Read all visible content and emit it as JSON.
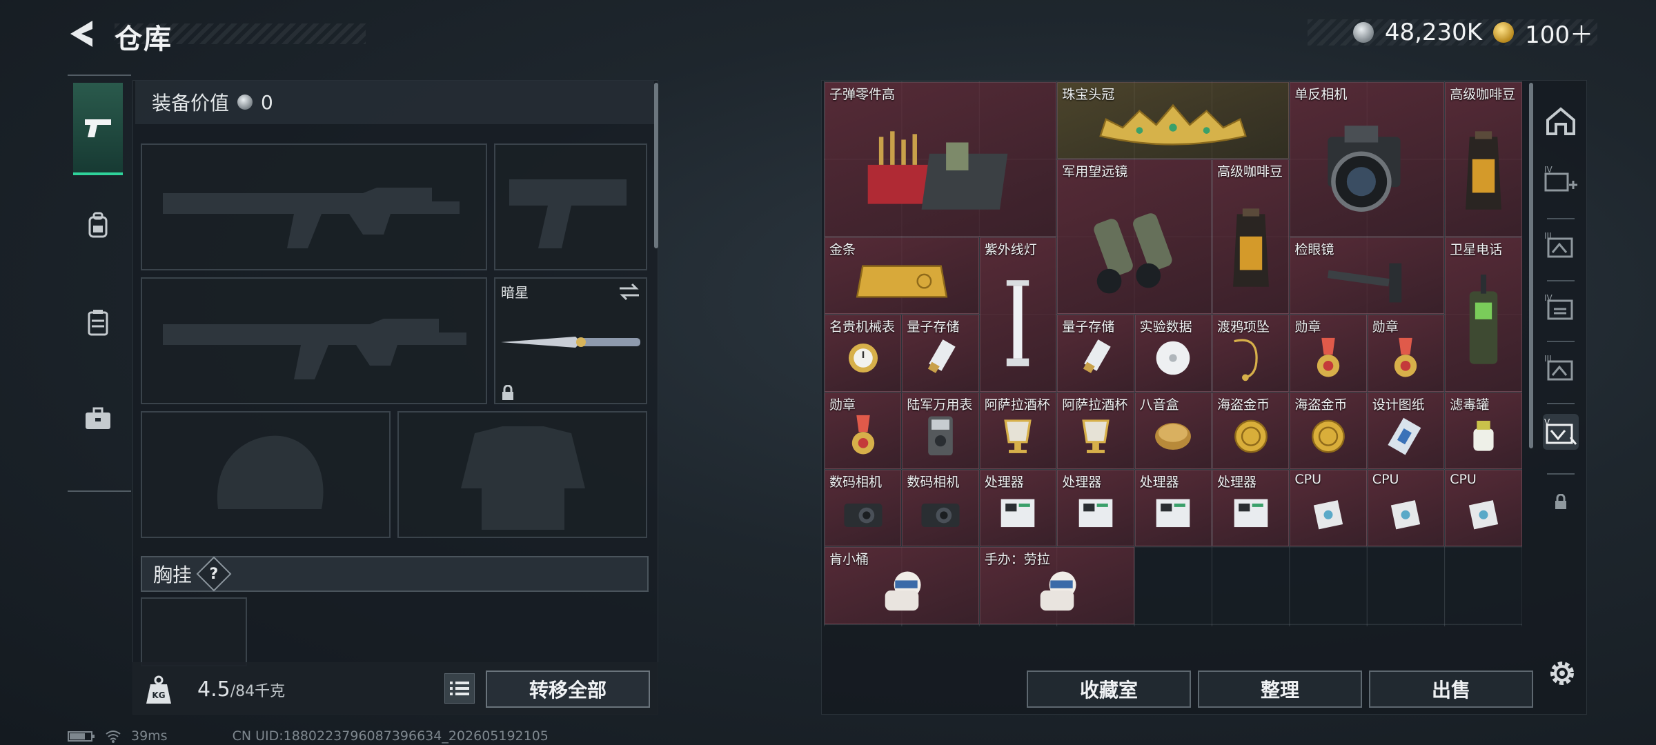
{
  "header": {
    "title": "仓库"
  },
  "currency": {
    "silver": "48,230K",
    "gold": "100＋"
  },
  "left": {
    "equip_label": "装备价值",
    "equip_value": "0",
    "slot_melee_label": "暗星",
    "chest_label": "胸挂",
    "chest_hint": "?",
    "weight_current": "4.5",
    "weight_max": "/84千克",
    "weight_badge": "KG",
    "transfer_label": "转移全部"
  },
  "items": [
    {
      "label": "子弹零件高",
      "rarity": "red"
    },
    {
      "label": "珠宝头冠",
      "rarity": "gold"
    },
    {
      "label": "单反相机",
      "rarity": "red"
    },
    {
      "label": "高级咖啡豆",
      "rarity": "red"
    },
    {
      "label": "军用望远镜",
      "rarity": "red"
    },
    {
      "label": "高级咖啡豆",
      "rarity": "red"
    },
    {
      "label": "金条",
      "rarity": "red"
    },
    {
      "label": "紫外线灯",
      "rarity": "red"
    },
    {
      "label": "检眼镜",
      "rarity": "red"
    },
    {
      "label": "卫星电话",
      "rarity": "red"
    },
    {
      "label": "名贵机械表",
      "rarity": "red"
    },
    {
      "label": "量子存储",
      "rarity": "red"
    },
    {
      "label": "量子存储",
      "rarity": "red"
    },
    {
      "label": "实验数据",
      "rarity": "red"
    },
    {
      "label": "渡鸦项坠",
      "rarity": "red"
    },
    {
      "label": "勋章",
      "rarity": "red"
    },
    {
      "label": "勋章",
      "rarity": "red"
    },
    {
      "label": "勋章",
      "rarity": "red"
    },
    {
      "label": "陆军万用表",
      "rarity": "red"
    },
    {
      "label": "阿萨拉酒杯",
      "rarity": "red"
    },
    {
      "label": "阿萨拉酒杯",
      "rarity": "red"
    },
    {
      "label": "八音盒",
      "rarity": "red"
    },
    {
      "label": "海盗金币",
      "rarity": "red"
    },
    {
      "label": "海盗金币",
      "rarity": "red"
    },
    {
      "label": "设计图纸",
      "rarity": "red"
    },
    {
      "label": "滤毒罐",
      "rarity": "red"
    },
    {
      "label": "数码相机",
      "rarity": "red"
    },
    {
      "label": "数码相机",
      "rarity": "red"
    },
    {
      "label": "处理器",
      "rarity": "red"
    },
    {
      "label": "处理器",
      "rarity": "red"
    },
    {
      "label": "处理器",
      "rarity": "red"
    },
    {
      "label": "处理器",
      "rarity": "red"
    },
    {
      "label": "CPU",
      "rarity": "red"
    },
    {
      "label": "CPU",
      "rarity": "red"
    },
    {
      "label": "CPU",
      "rarity": "red"
    },
    {
      "label": "肯小桶",
      "rarity": "red"
    },
    {
      "label": "手办：劳拉",
      "rarity": "red"
    }
  ],
  "actions": {
    "collection": "收藏室",
    "sort": "整理",
    "sell": "出售"
  },
  "status": {
    "ping": "39ms",
    "uid": "CN UID:1880223796087396634_202605192105"
  },
  "colors": {
    "accent": "#2fd39b",
    "red_rarity": "#6e303e",
    "gold_rarity": "#786432"
  }
}
